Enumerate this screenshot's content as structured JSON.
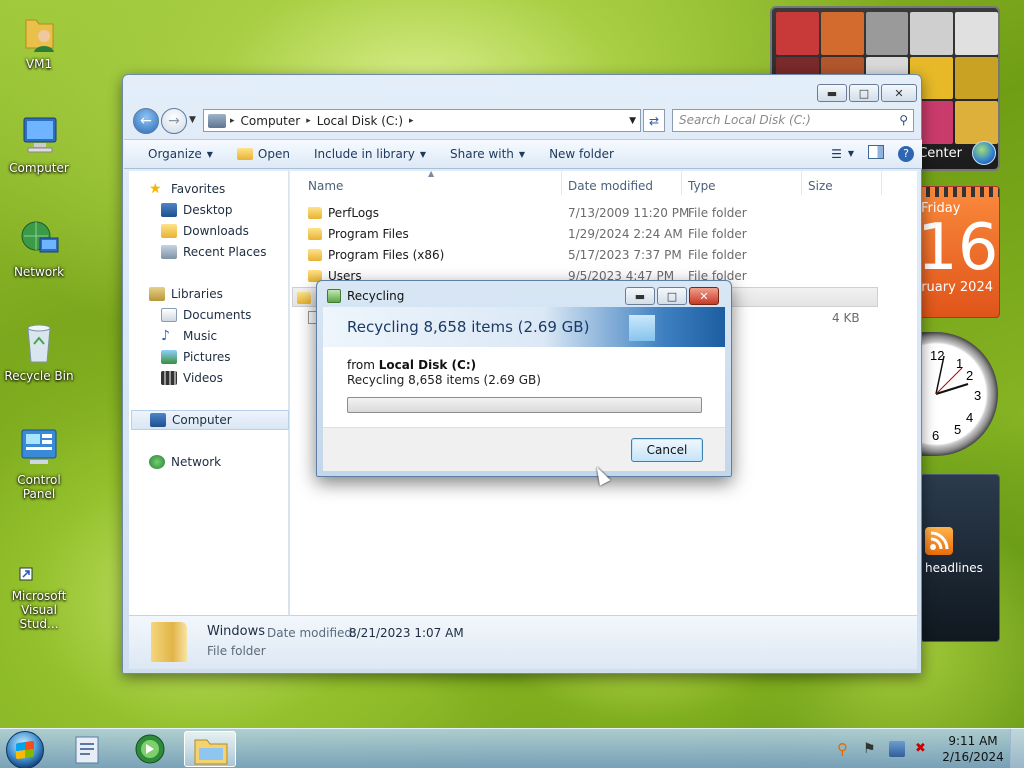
{
  "desktop": {
    "icons": [
      {
        "label": "VM1"
      },
      {
        "label": "Computer"
      },
      {
        "label": "Network"
      },
      {
        "label": "Recycle Bin"
      },
      {
        "label": "Control Panel"
      },
      {
        "label_line1": "Microsoft",
        "label_line2": "Visual Stud..."
      }
    ]
  },
  "gadgets": {
    "media_center": {
      "label": "Center"
    },
    "calendar": {
      "day": "Friday",
      "date": "16",
      "month": "ruary 2024"
    },
    "clock": {
      "numbers": [
        "12",
        "1",
        "2",
        "3",
        "4",
        "5",
        "6"
      ]
    },
    "feed": {
      "label": "headlines"
    }
  },
  "explorer": {
    "address": {
      "crumbs": [
        "Computer",
        "Local Disk (C:)"
      ]
    },
    "search": {
      "placeholder": "Search Local Disk (C:)"
    },
    "toolbar": {
      "organize": "Organize",
      "open": "Open",
      "include_in_library": "Include in library",
      "share_with": "Share with",
      "new_folder": "New folder"
    },
    "nav": {
      "favorites": "Favorites",
      "desktop": "Desktop",
      "downloads": "Downloads",
      "recent_places": "Recent Places",
      "libraries": "Libraries",
      "documents": "Documents",
      "music": "Music",
      "pictures": "Pictures",
      "videos": "Videos",
      "computer": "Computer",
      "network": "Network"
    },
    "columns": {
      "name": "Name",
      "date": "Date modified",
      "type": "Type",
      "size": "Size"
    },
    "rows": [
      {
        "name": "PerfLogs",
        "date": "7/13/2009 11:20 PM",
        "type": "File folder",
        "size": ""
      },
      {
        "name": "Program Files",
        "date": "1/29/2024 2:24 AM",
        "type": "File folder",
        "size": ""
      },
      {
        "name": "Program Files (x86)",
        "date": "5/17/2023 7:37 PM",
        "type": "File folder",
        "size": ""
      },
      {
        "name": "Users",
        "date": "9/5/2023 4:47 PM",
        "type": "File folder",
        "size": ""
      },
      {
        "name": "",
        "date": "",
        "type": "er",
        "size": ""
      },
      {
        "name": "",
        "date": "",
        "type": "",
        "size": "4 KB"
      }
    ],
    "details": {
      "name": "Windows",
      "date_label": "Date modified:",
      "date_value": "8/21/2023 1:07 AM",
      "type": "File folder"
    }
  },
  "dialog": {
    "title": "Recycling",
    "headline": "Recycling 8,658 items (2.69 GB)",
    "from_label": "from",
    "from_value": "Local Disk (C:)",
    "subline": "Recycling 8,658 items (2.69 GB)",
    "progress": 0,
    "cancel": "Cancel"
  },
  "taskbar": {
    "time": "9:11 AM",
    "date": "2/16/2024"
  }
}
